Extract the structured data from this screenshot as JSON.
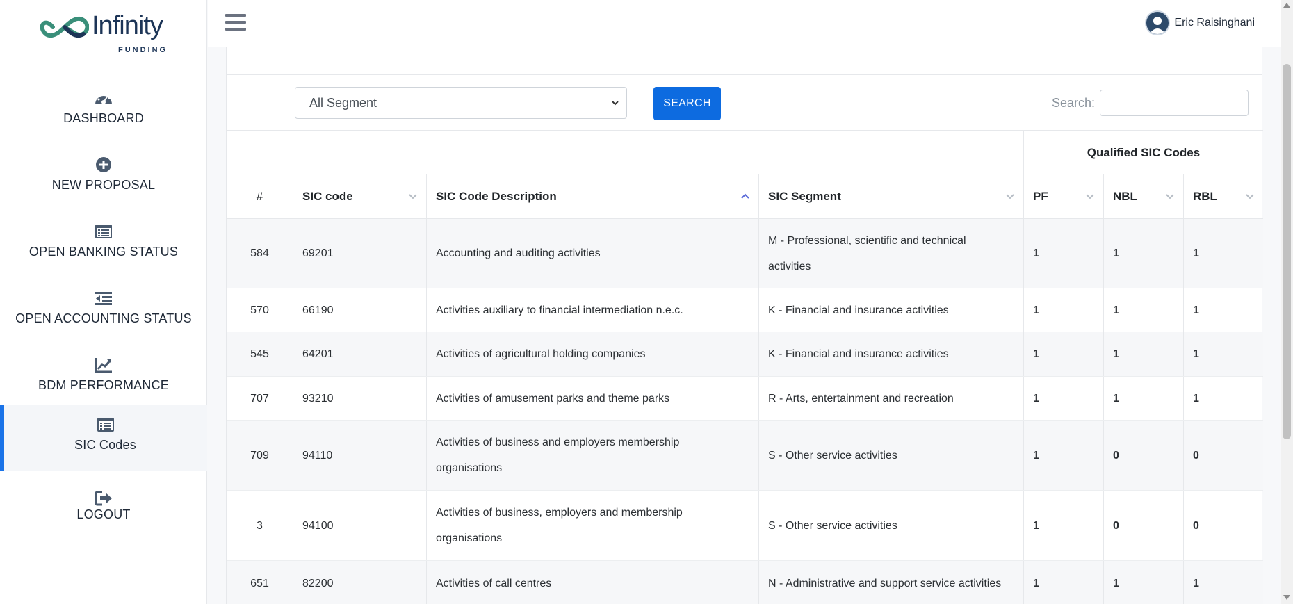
{
  "brand": {
    "name": "Infinity",
    "tagline": "FUNDING"
  },
  "sidebar": {
    "items": [
      {
        "label": "DASHBOARD",
        "icon": "dashboard-gauge-icon"
      },
      {
        "label": "NEW PROPOSAL",
        "icon": "plus-circle-icon"
      },
      {
        "label": "OPEN BANKING STATUS",
        "icon": "list-window-icon"
      },
      {
        "label": "OPEN ACCOUNTING STATUS",
        "icon": "indent-list-icon"
      },
      {
        "label": "BDM PERFORMANCE",
        "icon": "line-chart-icon"
      },
      {
        "label": "SIC Codes",
        "icon": "list-window-icon",
        "active": true
      },
      {
        "label": "LOGOUT",
        "icon": "logout-icon"
      }
    ]
  },
  "header": {
    "username": "Eric Raisinghani"
  },
  "filters": {
    "segment_selected": "All Segment",
    "search_button": "SEARCH",
    "search_label": "Search:"
  },
  "table": {
    "group_header": "Qualified SIC Codes",
    "columns": [
      "#",
      "SIC code",
      "SIC Code Description",
      "SIC Segment",
      "PF",
      "NBL",
      "RBL"
    ],
    "rows": [
      {
        "idx": "584",
        "code": "69201",
        "desc": "Accounting and auditing activities",
        "segment": "M - Professional, scientific and technical activities",
        "pf": "1",
        "nbl": "1",
        "rbl": "1"
      },
      {
        "idx": "570",
        "code": "66190",
        "desc": "Activities auxiliary to financial intermediation n.e.c.",
        "segment": "K - Financial and insurance activities",
        "pf": "1",
        "nbl": "1",
        "rbl": "1"
      },
      {
        "idx": "545",
        "code": "64201",
        "desc": "Activities of agricultural holding companies",
        "segment": "K - Financial and insurance activities",
        "pf": "1",
        "nbl": "1",
        "rbl": "1"
      },
      {
        "idx": "707",
        "code": "93210",
        "desc": "Activities of amusement parks and theme parks",
        "segment": "R - Arts, entertainment and recreation",
        "pf": "1",
        "nbl": "1",
        "rbl": "1"
      },
      {
        "idx": "709",
        "code": "94110",
        "desc": "Activities of business and employers membership organisations",
        "segment": "S - Other service activities",
        "pf": "1",
        "nbl": "0",
        "rbl": "0"
      },
      {
        "idx": "3",
        "code": "94100",
        "desc": "Activities of business, employers and membership organisations",
        "segment": "S - Other service activities",
        "pf": "1",
        "nbl": "0",
        "rbl": "0"
      },
      {
        "idx": "651",
        "code": "82200",
        "desc": "Activities of call centres",
        "segment": "N - Administrative and support service activities",
        "pf": "1",
        "nbl": "1",
        "rbl": "1"
      }
    ]
  },
  "colors": {
    "accent": "#0d6be0",
    "sidebar_active": "#1a73e8",
    "sort_active": "#5a6ad8"
  }
}
